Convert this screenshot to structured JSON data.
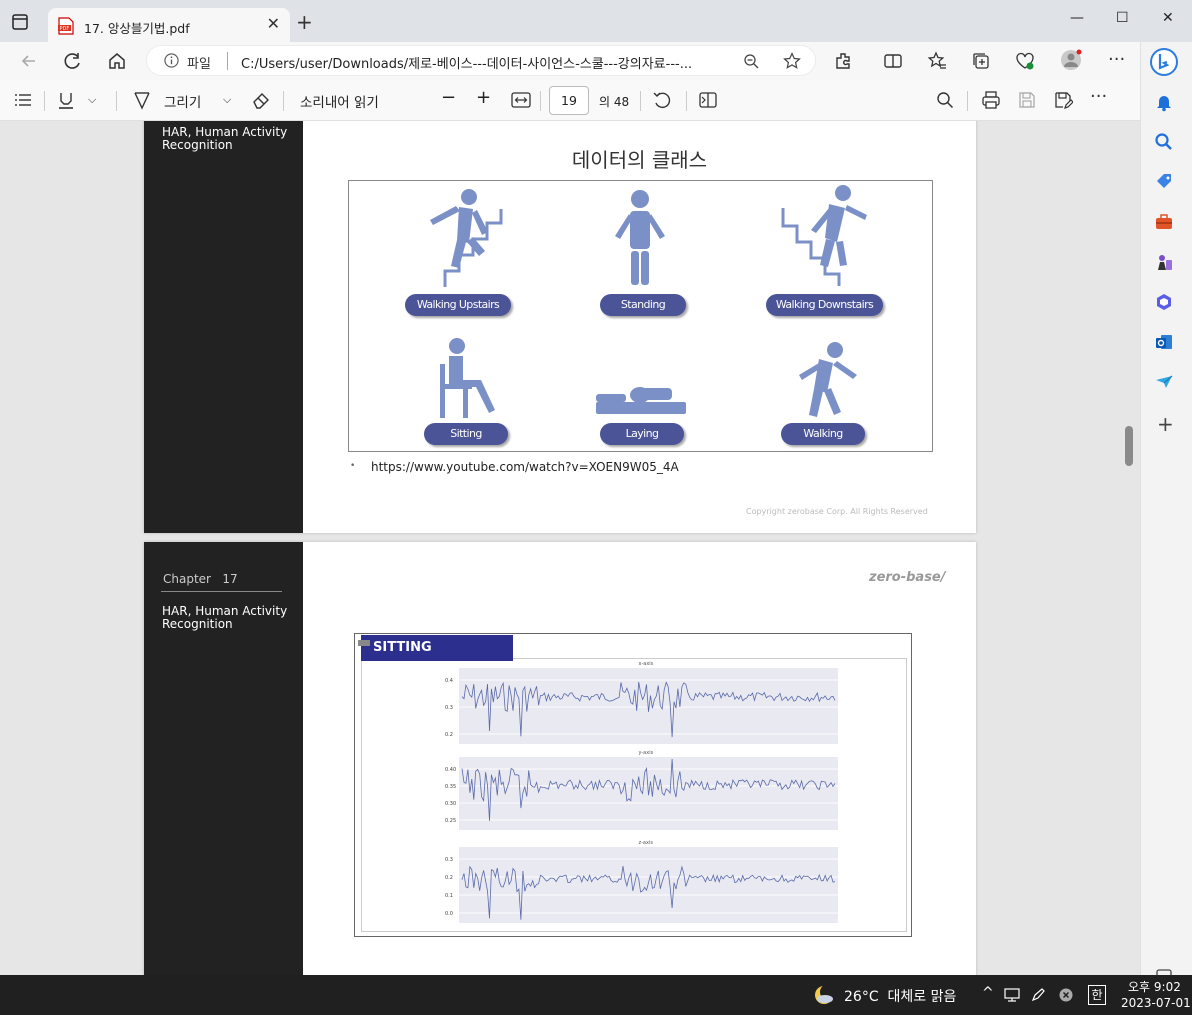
{
  "browser": {
    "tab_title": "17. 앙상블기법.pdf",
    "url_scheme": "파일",
    "url": "C:/Users/user/Downloads/제로-베이스---데이터-사이언스-스쿨---강의자료---..."
  },
  "pdf_toolbar": {
    "draw_label": "그리기",
    "read_aloud_label": "소리내어 읽기",
    "page_current": "19",
    "page_total": "의 48"
  },
  "page1": {
    "panel_title": "HAR, Human Activity Recognition",
    "title": "데이터의 클래스",
    "classes": [
      "Walking Upstairs",
      "Standing",
      "Walking Downstairs",
      "Sitting",
      "Laying",
      "Walking"
    ],
    "link": "https://www.youtube.com/watch?v=XOEN9W05_4A",
    "copyright": "Copyright zerobase Corp. All Rights Reserved"
  },
  "page2": {
    "panel_chapter": "Chapter   17",
    "panel_title": "HAR, Human Activity Recognition",
    "brand": "zero-base/",
    "banner": "SITTING"
  },
  "chart_data": {
    "type": "line",
    "title": "SITTING",
    "subplots": [
      {
        "title": "x-axis",
        "yticks": [
          "0.4",
          "0.3",
          "0.2"
        ],
        "ylim": [
          0.16,
          0.46
        ]
      },
      {
        "title": "y-axis",
        "yticks": [
          "0.40",
          "0.35",
          "0.30",
          "0.25"
        ],
        "ylim": [
          0.23,
          0.41
        ]
      },
      {
        "title": "z-axis",
        "yticks": [
          "0.3",
          "0.2",
          "0.1",
          "0.0"
        ],
        "ylim": [
          -0.02,
          0.35
        ]
      }
    ]
  },
  "taskbar": {
    "weather": "26°C  대체로 맑음",
    "ime": "한",
    "time": "오후 9:02",
    "date": "2023-07-01"
  }
}
